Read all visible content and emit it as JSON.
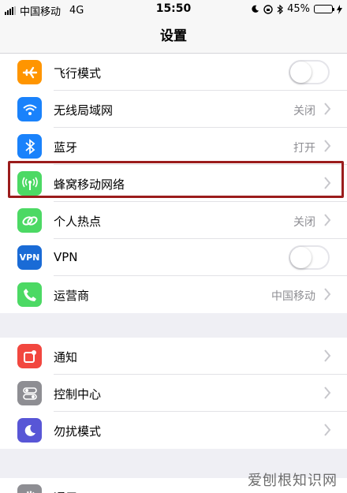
{
  "status_bar": {
    "carrier": "中国移动",
    "network": "4G",
    "time": "15:50",
    "battery": "45%",
    "battery_level": 0.45
  },
  "nav": {
    "title": "设置"
  },
  "group1": [
    {
      "label": "飞行模式",
      "icon": "airplane-icon",
      "color": "#ff9500",
      "control": "toggle",
      "on": false
    },
    {
      "label": "无线局域网",
      "icon": "wifi-icon",
      "color": "#1a82fb",
      "value": "关闭"
    },
    {
      "label": "蓝牙",
      "icon": "bluetooth-icon",
      "color": "#1a82fb",
      "value": "打开"
    },
    {
      "label": "蜂窝移动网络",
      "icon": "cellular-icon",
      "color": "#4cd964",
      "value": ""
    },
    {
      "label": "个人热点",
      "icon": "hotspot-icon",
      "color": "#4cd964",
      "value": "关闭"
    },
    {
      "label": "VPN",
      "icon": "vpn-icon",
      "icon_text": "VPN",
      "color": "#1a6bd6",
      "control": "toggle",
      "on": false
    },
    {
      "label": "运营商",
      "icon": "phone-icon",
      "color": "#4cd964",
      "value": "中国移动"
    }
  ],
  "group2": [
    {
      "label": "通知",
      "icon": "notification-icon",
      "color": "#f2473f"
    },
    {
      "label": "控制中心",
      "icon": "control-center-icon",
      "color": "#8e8e93"
    },
    {
      "label": "勿扰模式",
      "icon": "moon-icon",
      "color": "#5856d6"
    }
  ],
  "group3": [
    {
      "label": "通用",
      "icon": "gear-icon",
      "color": "#8e8e93"
    }
  ],
  "watermark": "爱刨根知识网"
}
